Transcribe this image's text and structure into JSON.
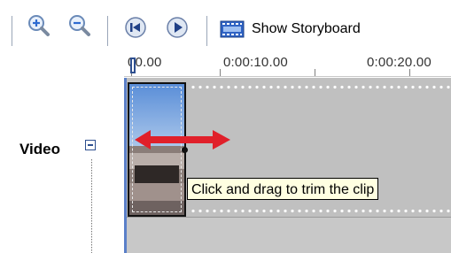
{
  "toolbar": {
    "zoom_in_icon": "magnifier-plus-icon",
    "zoom_out_icon": "magnifier-minus-icon",
    "rewind_icon": "rewind-icon",
    "play_icon": "play-icon",
    "storyboard_icon": "filmstrip-icon",
    "storyboard_label": "Show Storyboard"
  },
  "ruler": {
    "marks": [
      "00.00",
      "0:00:10.00",
      "0:00:20.00"
    ]
  },
  "track": {
    "label": "Video",
    "collapse_icon": "minus-box-icon"
  },
  "tooltip": {
    "text": "Click and drag to trim the clip"
  },
  "colors": {
    "accent_blue": "#2e4f8f",
    "trim_arrow_red": "#e0202a",
    "tooltip_bg": "#ffffe1",
    "track_gray": "#c0c0c0"
  }
}
